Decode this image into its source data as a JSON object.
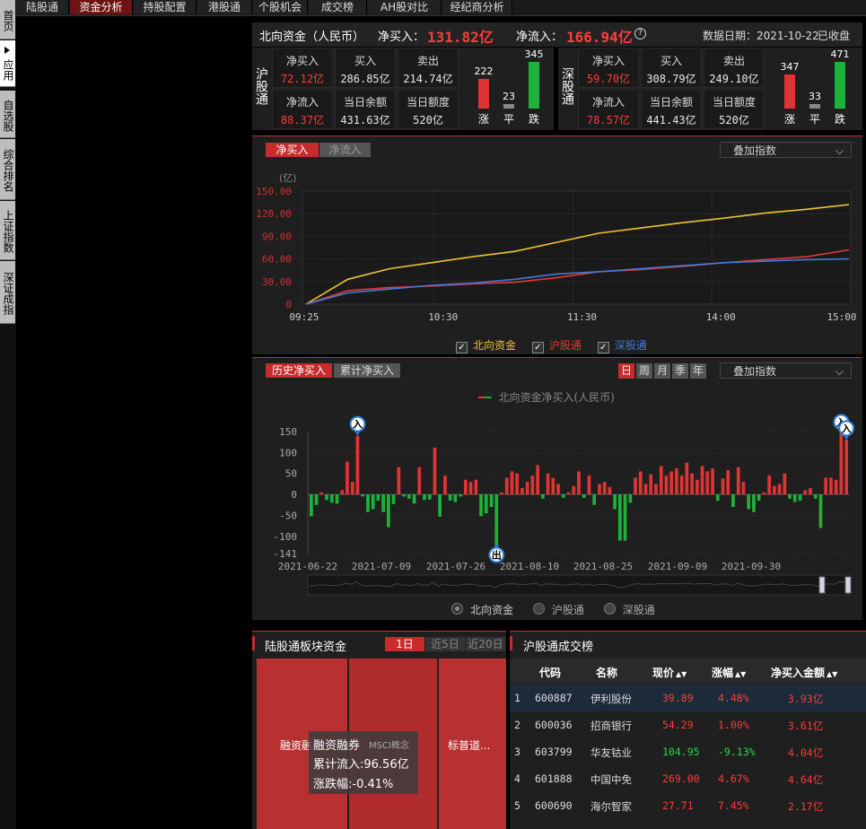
{
  "top_tabs": [
    "陆股通",
    "资金分析",
    "持股配置",
    "港股通",
    "个股机会",
    "成交榜",
    "AH股对比",
    "经纪商分析"
  ],
  "left_tabs": [
    "首页",
    "应用",
    "自选股",
    "综合排名",
    "上证指数",
    "深证成指"
  ],
  "summary": {
    "title": "北向资金（人民币）",
    "net_buy_label": "净买入：",
    "net_buy_value": "131.82亿",
    "net_inflow_label": "净流入：",
    "net_inflow_value": "166.94亿",
    "help_icon": "?",
    "date_label": "数据日期：2021-10-22",
    "status": "已收盘"
  },
  "sh": {
    "name": "沪股通",
    "net_buy_label": "净买入",
    "net_buy": "72.12亿",
    "buy_label": "买入",
    "buy": "286.85亿",
    "sell_label": "卖出",
    "sell": "214.74亿",
    "net_inflow_label": "净流入",
    "net_inflow": "88.37亿",
    "balance_label": "当日余额",
    "balance": "431.63亿",
    "quota_label": "当日额度",
    "quota": "520亿",
    "up": "222",
    "flat": "23",
    "down": "345",
    "up_label": "涨",
    "flat_label": "平",
    "down_label": "跌"
  },
  "sz": {
    "name": "深股通",
    "net_buy_label": "净买入",
    "net_buy": "59.70亿",
    "buy_label": "买入",
    "buy": "308.79亿",
    "sell_label": "卖出",
    "sell": "249.10亿",
    "net_inflow_label": "净流入",
    "net_inflow": "78.57亿",
    "balance_label": "当日余额",
    "balance": "441.43亿",
    "quota_label": "当日额度",
    "quota": "520亿",
    "up": "347",
    "flat": "33",
    "down": "471",
    "up_label": "涨",
    "flat_label": "平",
    "down_label": "跌"
  },
  "intraday": {
    "tab_a": "净买入",
    "tab_b": "净流入",
    "overlay": "叠加指数",
    "unit": "(亿)",
    "legend": [
      "北向资金",
      "沪股通",
      "深股通"
    ]
  },
  "history": {
    "tab_a": "历史净买入",
    "tab_b": "累计净买入",
    "periods": [
      "日",
      "周",
      "月",
      "季",
      "年"
    ],
    "overlay": "叠加指数",
    "legend": "北向资金净买入(人民币)",
    "radios": [
      "北向资金",
      "沪股通",
      "深股通"
    ],
    "marker_in": "入",
    "marker_out": "出"
  },
  "sector": {
    "title": "陆股通板块资金",
    "periods": [
      "1日",
      "近5日",
      "近20日"
    ],
    "blocks": [
      "融资融券",
      "",
      "标普道..."
    ],
    "tooltip": {
      "name": "融资融券",
      "tag": "MSCI概念",
      "line1": "累计流入:96.56亿",
      "line2": "涨跌幅:-0.41%"
    }
  },
  "ranking": {
    "title": "沪股通成交榜",
    "headers": [
      "代码",
      "名称",
      "现价",
      "涨幅",
      "净买入金额"
    ],
    "rows": [
      {
        "rank": "1",
        "code": "600887",
        "name": "伊利股份",
        "price": "39.89",
        "chg": "4.48%",
        "net": "3.93亿",
        "dir": "up"
      },
      {
        "rank": "2",
        "code": "600036",
        "name": "招商银行",
        "price": "54.29",
        "chg": "1.00%",
        "net": "3.61亿",
        "dir": "up"
      },
      {
        "rank": "3",
        "code": "603799",
        "name": "华友钴业",
        "price": "104.95",
        "chg": "-9.13%",
        "net": "4.04亿",
        "dir": "down"
      },
      {
        "rank": "4",
        "code": "601888",
        "name": "中国中免",
        "price": "269.00",
        "chg": "4.67%",
        "net": "4.64亿",
        "dir": "up"
      },
      {
        "rank": "5",
        "code": "600690",
        "name": "海尔智家",
        "price": "27.71",
        "chg": "7.45%",
        "net": "2.17亿",
        "dir": "up"
      }
    ]
  },
  "colors": {
    "north": "#f1c232",
    "sh": "#e53935",
    "sz": "#3d7bd9",
    "up": "#e03434",
    "down": "#1db33a"
  },
  "chart_data": [
    {
      "type": "line",
      "x_ticks": [
        "09:25",
        "10:30",
        "11:30",
        "14:00",
        "15:00"
      ],
      "ylabel": "(亿)",
      "y_ticks": [
        "150.00",
        "120.00",
        "90.00",
        "60.00",
        "30.00",
        "0"
      ],
      "ylim": [
        0,
        150
      ],
      "series": [
        {
          "name": "北向资金",
          "values": [
            0,
            33,
            47,
            55,
            63,
            70,
            82,
            94,
            101,
            108,
            114,
            121,
            126,
            132
          ]
        },
        {
          "name": "沪股通",
          "values": [
            0,
            18,
            22,
            24,
            27,
            29,
            35,
            43,
            46,
            50,
            55,
            59,
            63,
            72
          ]
        },
        {
          "name": "深股通",
          "values": [
            0,
            15,
            20,
            25,
            28,
            33,
            40,
            43,
            47,
            51,
            55,
            57,
            59,
            60
          ]
        }
      ]
    },
    {
      "type": "bar",
      "x_ticks": [
        "2021-06-22",
        "2021-07-09",
        "2021-07-26",
        "2021-08-10",
        "2021-08-25",
        "2021-09-09",
        "2021-09-30"
      ],
      "y_ticks": [
        "150",
        "100",
        "50",
        "0",
        "-50",
        "-100",
        "-141"
      ],
      "ylim": [
        -141,
        150
      ],
      "series": [
        {
          "name": "北向资金净买入(人民币)",
          "values": [
            -52,
            -25,
            5,
            -13,
            -20,
            -22,
            10,
            78,
            30,
            140,
            -5,
            -42,
            -35,
            -15,
            -42,
            -78,
            -23,
            65,
            -5,
            -10,
            -22,
            65,
            -13,
            -12,
            112,
            -53,
            45,
            -15,
            -18,
            -5,
            35,
            30,
            35,
            -52,
            -45,
            -30,
            -125,
            5,
            40,
            55,
            50,
            15,
            30,
            45,
            70,
            -10,
            50,
            40,
            25,
            -8,
            5,
            20,
            55,
            -8,
            45,
            -25,
            25,
            30,
            18,
            -35,
            -110,
            -110,
            -20,
            40,
            55,
            25,
            48,
            25,
            68,
            45,
            55,
            62,
            45,
            76,
            50,
            35,
            68,
            55,
            62,
            -15,
            38,
            58,
            -30,
            65,
            30,
            -35,
            -42,
            -15,
            5,
            45,
            20,
            25,
            50,
            -10,
            -18,
            -15,
            10,
            15,
            -10,
            -80,
            40,
            40,
            35,
            145,
            130
          ]
        }
      ]
    }
  ]
}
